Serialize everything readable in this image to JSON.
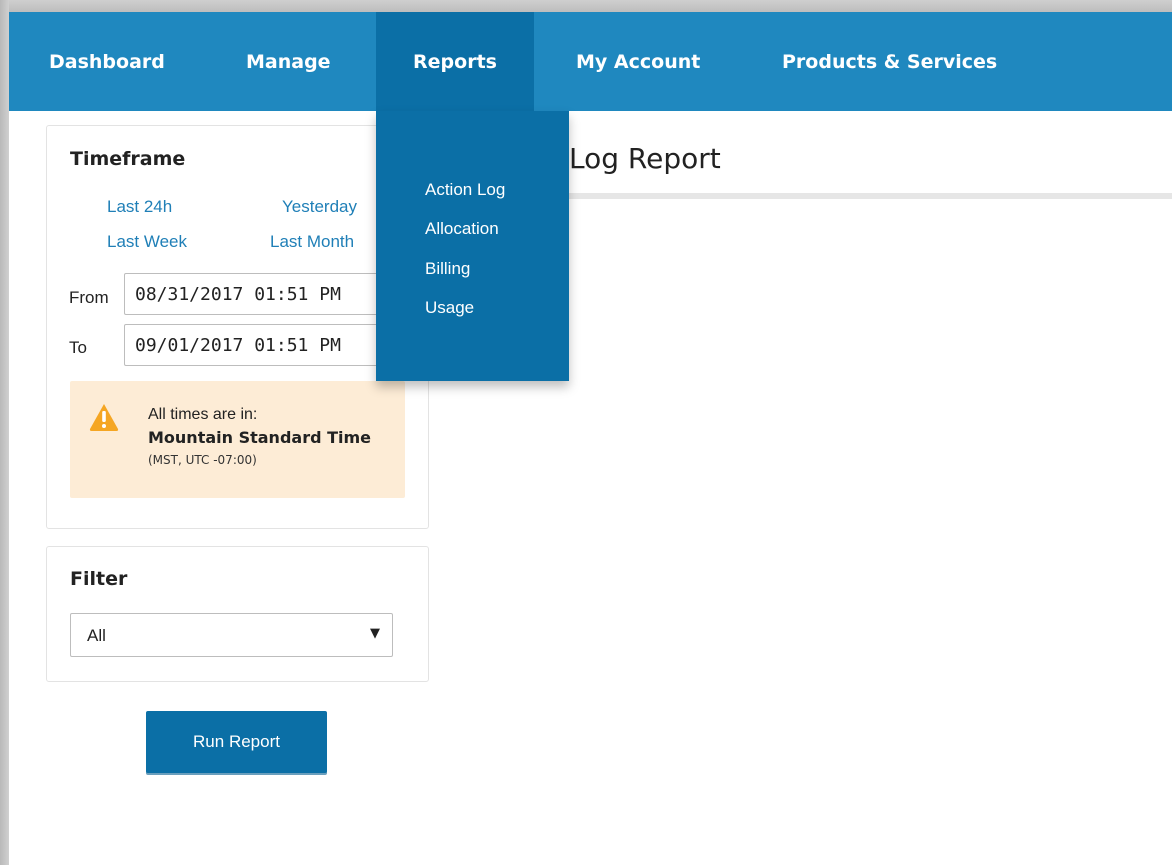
{
  "nav": {
    "items": [
      {
        "label": "Dashboard"
      },
      {
        "label": "Manage"
      },
      {
        "label": "Reports"
      },
      {
        "label": "My Account"
      },
      {
        "label": "Products & Services"
      }
    ],
    "active": "Reports"
  },
  "reports_menu": {
    "items": [
      {
        "label": "Action Log"
      },
      {
        "label": "Allocation"
      },
      {
        "label": "Billing"
      },
      {
        "label": "Usage"
      }
    ]
  },
  "page": {
    "title": "Log Report"
  },
  "timeframe": {
    "heading": "Timeframe",
    "quick_links": [
      "Last 24h",
      "Yesterday",
      "Last Week",
      "Last Month"
    ],
    "from_label": "From",
    "from_value": "08/31/2017 01:51 PM",
    "to_label": "To",
    "to_value": "09/01/2017 01:51 PM",
    "note": {
      "icon": "warning-icon",
      "line1": "All times are in:",
      "line2": "Mountain Standard Time",
      "line3": "(MST, UTC -07:00)"
    }
  },
  "filter": {
    "heading": "Filter",
    "selected": "All"
  },
  "actions": {
    "run_label": "Run Report"
  },
  "colors": {
    "nav_bg": "#1f88bf",
    "nav_active": "#0b6fa6",
    "link": "#1f7fb7",
    "warning_bg": "#fdecd6",
    "warning_icon": "#f5a623"
  }
}
